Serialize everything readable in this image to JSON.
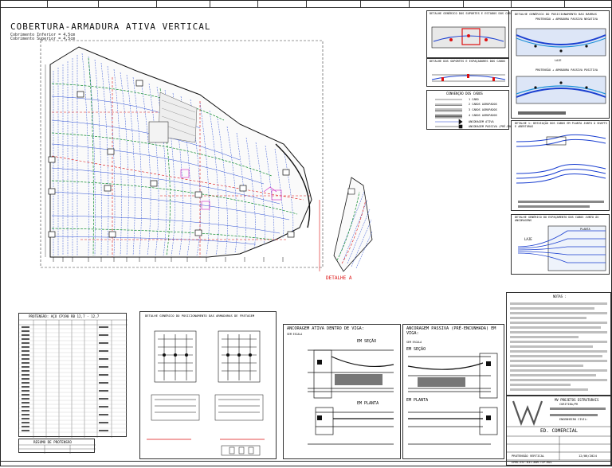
{
  "plan": {
    "title": "COBERTURA-ARMADURA ATIVA VERTICAL",
    "subtitle_1": "Cobrimento Inferior = 4,5cm",
    "subtitle_2": "Cobrimento Superior = 4,5cm",
    "detail_a_label": "DETALHE A"
  },
  "details": {
    "supports_title": "DETALHE GENÉRICO DOS SUPORTES E ESTADOS DOS CABOS",
    "supports_spacers_title": "DETALHE DOS SUPORTES E ESPAÇADORES DOS CABOS",
    "bars_title": "DETALHE GENÉRICO DO POSICIONAMENTO DAS BARRAS",
    "negative_title": "PROTENSÃO + ARMADURA PASSIVA NEGATIVA",
    "positive_title": "PROTENSÃO + ARMADURA PASSIVA POSITIVA",
    "deviation_title": "DETALHE 1: DESVIAÇÃO DOS CABOS EM PLANTA JUNTO À SHAFTS E ABERTURAS",
    "spacing_title": "DETALHE GENÉRICO DO ESPAÇAMENTO DOS CABOS JUNTO ÀS ANCORAGENS",
    "bursting_title": "DETALHE GENÉRICO DO POSICIONAMENTO DAS ARMADURAS DE FRETAGEM",
    "slab_label": "LAJE",
    "plant_label": "PLANTA"
  },
  "conventions": {
    "title": "CONVENÇÃO DOS CABOS",
    "items": [
      "1 CABO",
      "2 CABOS AGRUPADOS",
      "3 CABOS AGRUPADOS",
      "4 CABOS AGRUPADOS",
      "ANCORAGEM ATIVA",
      "ANCORAGEM PASSIVA (PRÉ-ENCUNHADA)"
    ]
  },
  "table": {
    "title": "PROTENSÃO: AÇO CP190 RB 12,7 - 12,7",
    "summary_title": "RESUMO DE PROTENSÃO"
  },
  "anchorage": {
    "active_title": "ANCORAGEM ATIVA DENTRO DE VIGA:",
    "passive_title": "ANCORAGEM PASSIVA (PRÉ-ENCUNHADA) EM VIGA:",
    "no_scale": "SEM ESCALA",
    "in_section": "EM SEÇÃO",
    "in_plant": "EM PLANTA"
  },
  "notes": {
    "title": "NOTAS :"
  },
  "title_block": {
    "company": "MV PROJETOS ESTRUTURAIS",
    "city": "CURITIBA/PR",
    "role": "ENGENHEIRO CIVIL:",
    "building": "ED. COMERCIAL",
    "sheet_name": "PROTENSÃO VERTICAL",
    "date": "12/06/2024",
    "sheet_code": "EPMS-EST-631-ARM-TIP-R01"
  },
  "colors": {
    "grid": "#1a3fd0",
    "cable": "#d11",
    "line": "#111",
    "green": "#0a8a2a",
    "cyan": "#1b8fd8",
    "magenta": "#d020c0"
  }
}
